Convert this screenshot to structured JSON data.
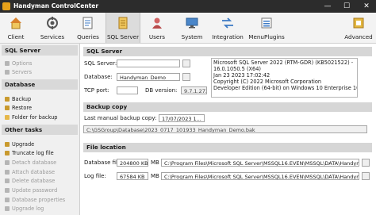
{
  "window": {
    "title": "Handyman ControlCenter",
    "minimize": "—",
    "maximize": "☐",
    "close": "✕"
  },
  "toolbar": {
    "items": [
      {
        "label": "Client",
        "icon": "client-icon"
      },
      {
        "label": "Services",
        "icon": "services-icon"
      },
      {
        "label": "Queries",
        "icon": "queries-icon"
      },
      {
        "label": "SQL Server",
        "icon": "sql-server-icon",
        "active": true
      },
      {
        "label": "Users",
        "icon": "users-icon"
      },
      {
        "label": "System",
        "icon": "system-icon"
      },
      {
        "label": "Integration",
        "icon": "integration-icon"
      },
      {
        "label": "MenuPlugins",
        "icon": "menu-plugins-icon"
      },
      {
        "label": "Advanced",
        "icon": "advanced-icon"
      }
    ]
  },
  "sidebar": {
    "sql_server": {
      "title": "SQL Server",
      "items": [
        "Options",
        "Servers"
      ]
    },
    "database": {
      "title": "Database",
      "items": [
        "Backup",
        "Restore",
        "Folder for backup"
      ]
    },
    "other_tasks": {
      "title": "Other tasks",
      "items": [
        "Upgrade",
        "Truncate log file",
        "Detach database",
        "Attach database",
        "Delete database",
        "Update password",
        "Database properties",
        "Upgrade log"
      ]
    }
  },
  "sql_server": {
    "title": "SQL Server",
    "server_label": "SQL Server:",
    "server_value": "",
    "database_label": "Database:",
    "database_value": "Handyman_Demo",
    "tcp_label": "TCP port:",
    "tcp_value": "",
    "db_version_label": "DB version:",
    "db_version_value": "9.7.1.2730",
    "info_lines": [
      "Microsoft SQL Server 2022 (RTM-GDR) (KB5021522) -",
      "16.0.1050.5 (X64)",
      "Jan 23 2023 17:02:42",
      "Copyright (C) 2022 Microsoft Corporation",
      "Developer Edition (64-bit) on Windows 10 Enterprise 10.0"
    ]
  },
  "backup": {
    "title": "Backup copy",
    "last_label": "Last manual backup copy:",
    "last_value": "17/07/2023 1...",
    "path": "C:\\GSGroup\\Database\\2023_0717_101933_Handyman_Demo.bak"
  },
  "file_location": {
    "title": "File location",
    "db_file_label": "Database file:",
    "db_file_size": "204800 KB",
    "db_file_unit": "MB",
    "db_file_path": "C:\\Program Files\\Microsoft SQL Server\\MSSQL16.EVEN\\MSSQL\\DATA\\Handyman...",
    "log_file_label": "Log file:",
    "log_file_size": "67584 KB",
    "log_file_unit": "MB",
    "log_file_path": "C:\\Program Files\\Microsoft SQL Server\\MSSQL16.EVEN\\MSSQL\\DATA\\Handyman..."
  },
  "colors": {
    "accent": "#e6a11a",
    "titlebar": "#2c2c2c",
    "enabled_icon": "#c99a2e",
    "disabled_icon": "#b5b5b5"
  }
}
